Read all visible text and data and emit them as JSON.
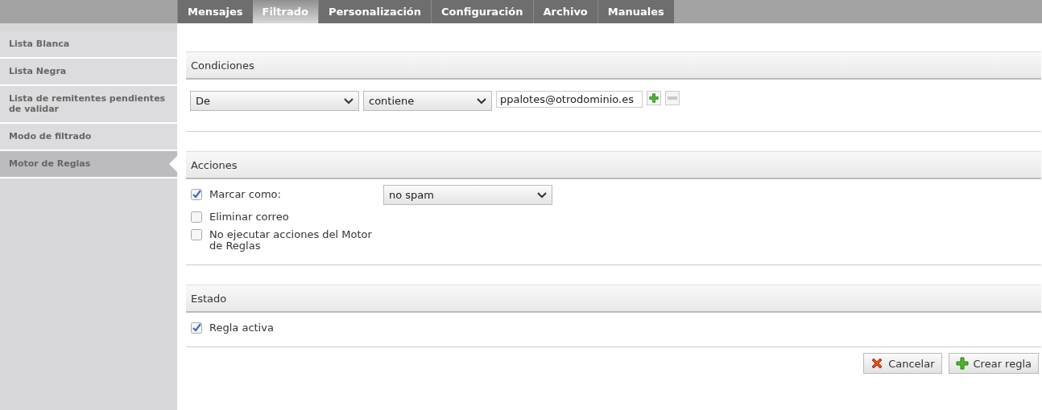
{
  "tabs": [
    {
      "label": "Mensajes",
      "selected": false
    },
    {
      "label": "Filtrado",
      "selected": true
    },
    {
      "label": "Personalización",
      "selected": false
    },
    {
      "label": "Configuración",
      "selected": false
    },
    {
      "label": "Archivo",
      "selected": false
    },
    {
      "label": "Manuales",
      "selected": false
    }
  ],
  "sidebar": {
    "items": [
      {
        "label": "Lista Blanca",
        "selected": false
      },
      {
        "label": "Lista Negra",
        "selected": false
      },
      {
        "label": "Lista de remitentes pendientes de validar",
        "selected": false
      },
      {
        "label": "Modo de filtrado",
        "selected": false
      },
      {
        "label": "Motor de Reglas",
        "selected": true
      }
    ]
  },
  "conditions": {
    "title": "Condiciones",
    "rows": [
      {
        "field": "De",
        "operator": "contiene",
        "value": "ppalotes@otrodominio.es"
      }
    ]
  },
  "actions": {
    "title": "Acciones",
    "items": [
      {
        "label": "Marcar como:",
        "checked": true,
        "select": "no spam"
      },
      {
        "label": "Eliminar correo",
        "checked": false
      },
      {
        "label": "No ejecutar acciones del Motor de Reglas",
        "checked": false
      }
    ]
  },
  "status": {
    "title": "Estado",
    "items": [
      {
        "label": "Regla activa",
        "checked": true
      }
    ]
  },
  "buttons": [
    {
      "kind": "cancel",
      "label": "Cancelar"
    },
    {
      "kind": "create",
      "label": "Crear regla"
    }
  ]
}
